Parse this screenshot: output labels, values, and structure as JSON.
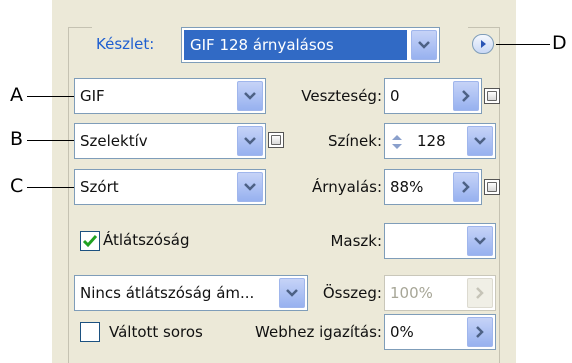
{
  "preset": {
    "label": "Készlet:",
    "value": "GIF 128 árnyalásos"
  },
  "callouts": {
    "a": "A",
    "b": "B",
    "c": "C",
    "d": "D"
  },
  "format": {
    "value": "GIF"
  },
  "lossy": {
    "label": "Veszteség:",
    "value": "0"
  },
  "reduction": {
    "value": "Szelektív"
  },
  "colors": {
    "label": "Színek:",
    "value": "128"
  },
  "dither_algo": {
    "value": "Szórt"
  },
  "dither": {
    "label": "Árnyalás:",
    "value": "88%"
  },
  "transparency": {
    "label": "Átlátszóság",
    "checked": true
  },
  "matte": {
    "label": "Maszk:",
    "value": ""
  },
  "transparency_dither": {
    "value": "Nincs átlátszóság ám..."
  },
  "amount": {
    "label": "Összeg:",
    "value": "100%"
  },
  "interlaced": {
    "label": "Váltott soros",
    "checked": false
  },
  "web_snap": {
    "label": "Webhez igazítás:",
    "value": "0%"
  },
  "colors_ui": {
    "panel_bg": "#ece9d8",
    "accent_blue": "#316ac5",
    "label_blue": "#1f5fd0",
    "field_border": "#7f9db9"
  }
}
